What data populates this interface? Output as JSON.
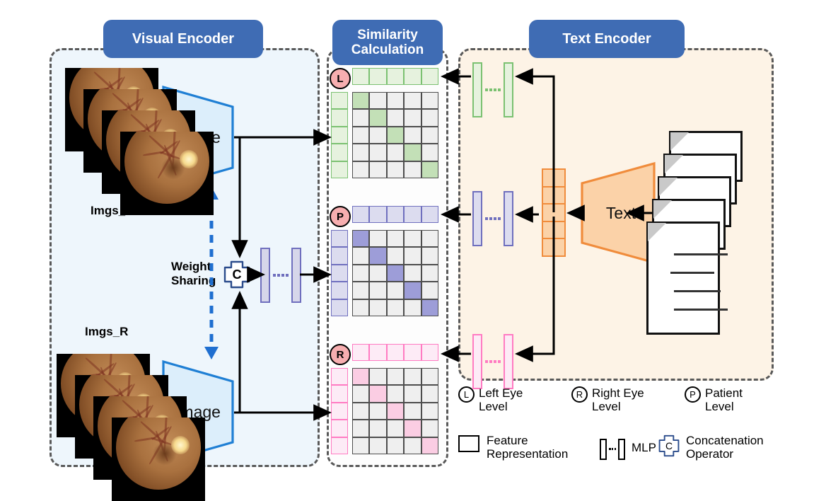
{
  "panels": {
    "visual": {
      "title": "Visual Encoder",
      "bg": "#eef6fc"
    },
    "similarity": {
      "title": "Similarity\nCalculation",
      "bg": "#fdfdfd"
    },
    "text": {
      "title": "Text Encoder",
      "bg": "#fdf3e6"
    }
  },
  "visual_encoder": {
    "top_stack_label": "Imgs_L",
    "bottom_stack_label": "Imgs_R",
    "top_encoder_label": "Image",
    "bottom_encoder_label": "Image",
    "weight_sharing_label": "Weight\nSharing",
    "concat_label": "C",
    "stack_count": 4,
    "encoder_color": "#1f7fd4",
    "encoder_fill": "#dceefb"
  },
  "text_encoder": {
    "encoder_label": "Text",
    "encoder_color": "#f08c3c",
    "encoder_fill": "#fbd2a8",
    "feature_column_cells": 5,
    "document_count": 5
  },
  "matrices": [
    {
      "id": "left-eye",
      "badge": "L",
      "accent": "#7bc171",
      "header_fill": "#e6f2de",
      "cell_fill": "#efefef",
      "diagonal_fill": "#c3e0b7",
      "rows": 5,
      "cols": 5,
      "diagonal": [
        0,
        1,
        2,
        3,
        4
      ]
    },
    {
      "id": "patient",
      "badge": "P",
      "accent": "#6f6fbe",
      "header_fill": "#dcdcef",
      "cell_fill": "#efefef",
      "diagonal_fill": "#9d9dd8",
      "rows": 5,
      "cols": 5,
      "diagonal": [
        0,
        1,
        2,
        3,
        4
      ]
    },
    {
      "id": "right-eye",
      "badge": "R",
      "accent": "#ff7bc2",
      "header_fill": "#fdebf6",
      "cell_fill": "#efefef",
      "diagonal_fill": "#fbcde3",
      "rows": 5,
      "cols": 5,
      "diagonal": [
        0,
        1,
        2,
        3,
        4
      ]
    }
  ],
  "mlps": [
    {
      "id": "green",
      "border": "#7bc171",
      "fill": "#e6f2de",
      "dots": "#7bc171"
    },
    {
      "id": "purple-text",
      "border": "#6f6fbe",
      "fill": "#dcdcef",
      "dots": "#6f6fbe"
    },
    {
      "id": "pink",
      "border": "#ff7bc2",
      "fill": "#fdebf6",
      "dots": "#ff7bc2"
    },
    {
      "id": "purple-visual",
      "border": "#6f6fbe",
      "fill": "#d6d6ea",
      "dots": "#6f6fbe"
    }
  ],
  "legend": {
    "levels": [
      {
        "symbol": "L",
        "text": "Left Eye\nLevel"
      },
      {
        "symbol": "R",
        "text": "Right Eye\nLevel"
      },
      {
        "symbol": "P",
        "text": "Patient\nLevel"
      }
    ],
    "items": [
      {
        "icon": "square",
        "text": "Feature\nRepresentation"
      },
      {
        "icon": "mlp",
        "text": "MLP"
      },
      {
        "icon": "concat",
        "text": "Concatenation\nOperator",
        "symbol": "C"
      }
    ]
  },
  "colors": {
    "panel_border": "#595959",
    "pill_bg": "#3f6cb4",
    "arrow": "#000000",
    "weight_sharing_arrow": "#1f6fd0",
    "badge_bg": "#f7aeb0"
  }
}
